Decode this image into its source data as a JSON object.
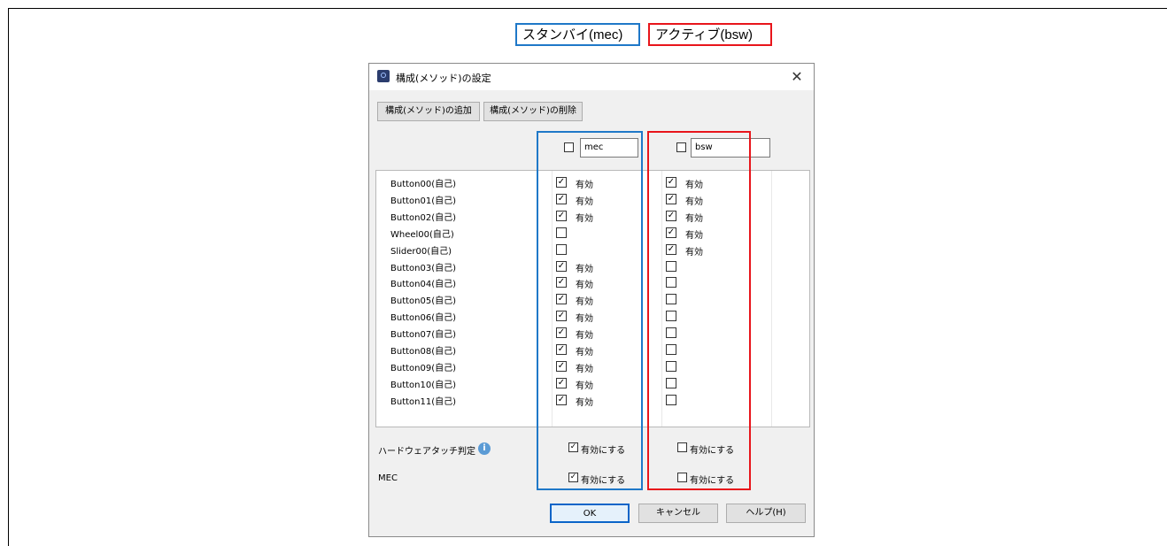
{
  "legend": {
    "mec_label": "スタンバイ(mec)",
    "bsw_label": "アクティブ(bsw)",
    "mec_color": "#1f78c8",
    "bsw_color": "#e8151b"
  },
  "dialog": {
    "title": "構成(メソッド)の設定",
    "close_icon": "close-icon",
    "add_button": "構成(メソッド)の追加",
    "delete_button": "構成(メソッド)の削除",
    "columns": [
      {
        "name": "mec",
        "checked": false
      },
      {
        "name": "bsw",
        "checked": false
      }
    ],
    "rows": [
      {
        "label": "Button00(自己)",
        "mec": true,
        "bsw": true
      },
      {
        "label": "Button01(自己)",
        "mec": true,
        "bsw": true
      },
      {
        "label": "Button02(自己)",
        "mec": true,
        "bsw": true
      },
      {
        "label": "Wheel00(自己)",
        "mec": false,
        "bsw": true
      },
      {
        "label": "Slider00(自己)",
        "mec": false,
        "bsw": true
      },
      {
        "label": "Button03(自己)",
        "mec": true,
        "bsw": false
      },
      {
        "label": "Button04(自己)",
        "mec": true,
        "bsw": false
      },
      {
        "label": "Button05(自己)",
        "mec": true,
        "bsw": false
      },
      {
        "label": "Button06(自己)",
        "mec": true,
        "bsw": false
      },
      {
        "label": "Button07(自己)",
        "mec": true,
        "bsw": false
      },
      {
        "label": "Button08(自己)",
        "mec": true,
        "bsw": false
      },
      {
        "label": "Button09(自己)",
        "mec": true,
        "bsw": false
      },
      {
        "label": "Button10(自己)",
        "mec": true,
        "bsw": false
      },
      {
        "label": "Button11(自己)",
        "mec": true,
        "bsw": false
      }
    ],
    "enabled_text": "有効",
    "options": [
      {
        "label": "ハードウェアタッチ判定",
        "mec": true,
        "bsw": false
      },
      {
        "label": "MEC",
        "mec": true,
        "bsw": false
      }
    ],
    "enable_text": "有効にする",
    "ok_button": "OK",
    "cancel_button": "キャンセル",
    "help_button": "ヘルプ(H)"
  }
}
